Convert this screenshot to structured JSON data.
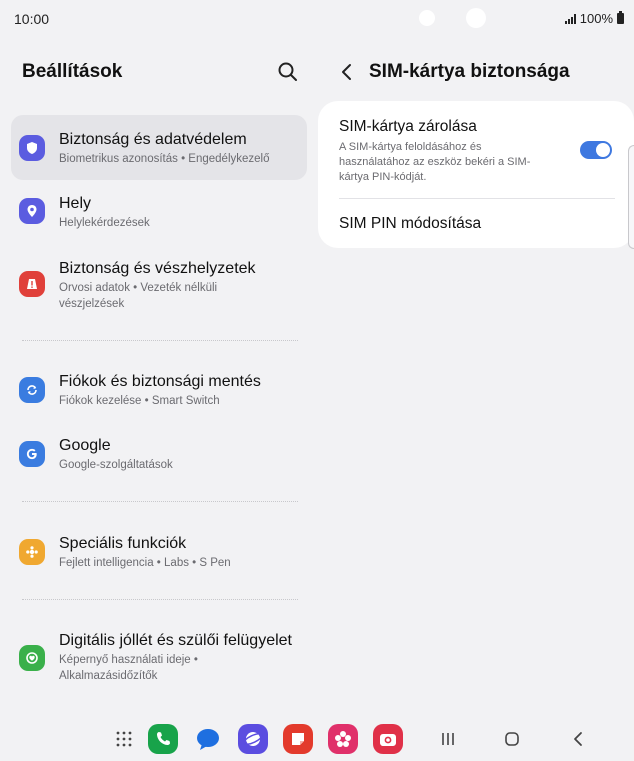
{
  "status_bar": {
    "time": "10:00",
    "battery": "100%"
  },
  "left_panel": {
    "title": "Beállítások",
    "items": [
      {
        "title": "Biztonság és adatvédelem",
        "subtitle": "Biometrikus azonosítás  •  Engedélykezelő",
        "icon": "shield-icon",
        "color": "#5b5ce0"
      },
      {
        "title": "Hely",
        "subtitle": "Helylekérdezések",
        "icon": "location-pin-icon",
        "color": "#5b5ce0"
      },
      {
        "title": "Biztonság és vészhelyzetek",
        "subtitle": "Orvosi adatok  •  Vezeték nélküli vészjelzések",
        "icon": "emergency-icon",
        "color": "#e0403a"
      },
      {
        "title": "Fiókok és biztonsági mentés",
        "subtitle": "Fiókok kezelése  •  Smart Switch",
        "icon": "sync-icon",
        "color": "#3a7ce0"
      },
      {
        "title": "Google",
        "subtitle": "Google-szolgáltatások",
        "icon": "google-icon",
        "color": "#3a7ce0"
      },
      {
        "title": "Speciális funkciók",
        "subtitle": "Fejlett intelligencia  •  Labs  •  S Pen",
        "icon": "advanced-features-icon",
        "color": "#f0a830"
      },
      {
        "title": "Digitális jóllét és szülői felügyelet",
        "subtitle": "Képernyő használati ideje  •  Alkalmazásidőzítők",
        "icon": "wellbeing-icon",
        "color": "#3ab04a"
      }
    ]
  },
  "right_panel": {
    "title": "SIM-kártya biztonsága",
    "sim_lock": {
      "title": "SIM-kártya zárolása",
      "description": "A SIM-kártya feloldásához és használatához az eszköz bekéri a SIM-kártya PIN-kódját.",
      "enabled": true
    },
    "change_pin": {
      "title": "SIM PIN módosítása"
    }
  },
  "colors": {
    "accent": "#3e78e0",
    "background": "#f2f2f4",
    "card": "#ffffff"
  },
  "dock": {
    "apps": [
      "app-drawer-icon",
      "phone-icon",
      "messages-icon",
      "internet-icon",
      "notes-icon",
      "gallery-icon",
      "camera-icon"
    ],
    "nav": [
      "recents-icon",
      "home-icon",
      "back-icon"
    ]
  }
}
